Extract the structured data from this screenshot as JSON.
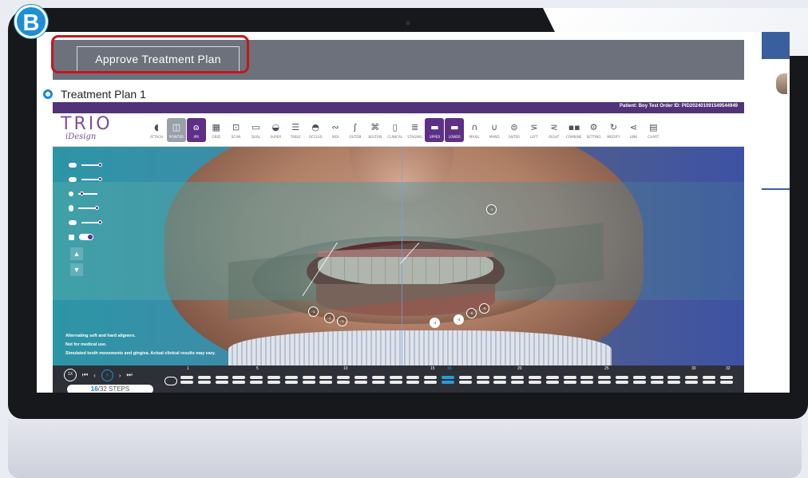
{
  "badge": "B",
  "approve_button": "Approve Treatment Plan",
  "plan_label": "Treatment Plan 1",
  "app": {
    "patient_info": "Patient: Boy Test   Order ID: PID202401091549544949",
    "logo_main": "TRIO",
    "logo_sub": "iDesign",
    "tools": [
      {
        "label": "ATTACH",
        "icon": "attach-icon",
        "glyph": "◖",
        "state": "normal"
      },
      {
        "label": "POINTER",
        "icon": "pointer-icon",
        "glyph": "◫",
        "state": "grey"
      },
      {
        "label": "IPR",
        "icon": "ipr-icon",
        "glyph": "ɷ",
        "state": "active"
      },
      {
        "label": "GRID",
        "icon": "grid-icon",
        "glyph": "▦",
        "state": "normal"
      },
      {
        "label": "SCAN",
        "icon": "scan-icon",
        "glyph": "⊡",
        "state": "normal"
      },
      {
        "label": "DUAL",
        "icon": "dual-icon",
        "glyph": "▭",
        "state": "normal"
      },
      {
        "label": "SUPER",
        "icon": "super-icon",
        "glyph": "◒",
        "state": "normal"
      },
      {
        "label": "TABLE",
        "icon": "table-icon",
        "glyph": "☰",
        "state": "normal"
      },
      {
        "label": "OCCLUS",
        "icon": "occlusion-icon",
        "glyph": "◓",
        "state": "normal"
      },
      {
        "label": "MDI",
        "icon": "mdi-icon",
        "glyph": "∾",
        "state": "normal"
      },
      {
        "label": "OUTDB",
        "icon": "outdb-icon",
        "glyph": "ʃ",
        "state": "normal"
      },
      {
        "label": "BOLTON",
        "icon": "bolton-icon",
        "glyph": "⌘",
        "state": "normal"
      },
      {
        "label": "CLINICAL",
        "icon": "clinical-icon",
        "glyph": "▯",
        "state": "normal"
      },
      {
        "label": "STAGING",
        "icon": "staging-icon",
        "glyph": "≣",
        "state": "normal"
      },
      {
        "label": "UPPER",
        "icon": "upper-jaw-icon",
        "glyph": "▬",
        "state": "active"
      },
      {
        "label": "LOWER",
        "icon": "lower-jaw-icon",
        "glyph": "▬",
        "state": "active"
      },
      {
        "label": "MAXIL",
        "icon": "maxilla-icon",
        "glyph": "∩",
        "state": "normal"
      },
      {
        "label": "MAND",
        "icon": "mandible-icon",
        "glyph": "∪",
        "state": "normal"
      },
      {
        "label": "ANTER",
        "icon": "anterior-icon",
        "glyph": "⊜",
        "state": "normal"
      },
      {
        "label": "LEFT",
        "icon": "left-view-icon",
        "glyph": "⋝",
        "state": "normal"
      },
      {
        "label": "RIGHT",
        "icon": "right-view-icon",
        "glyph": "⋜",
        "state": "normal"
      },
      {
        "label": "COMBINE",
        "icon": "combine-icon",
        "glyph": "▪▪",
        "state": "normal"
      },
      {
        "label": "SETTING",
        "icon": "setting-icon",
        "glyph": "⚙",
        "state": "normal"
      },
      {
        "label": "MODIFY",
        "icon": "modify-icon",
        "glyph": "↻",
        "state": "normal"
      },
      {
        "label": "LINK",
        "icon": "link-icon",
        "glyph": "⋖",
        "state": "normal"
      },
      {
        "label": "CHART",
        "icon": "chart-icon",
        "glyph": "▤",
        "state": "normal"
      }
    ],
    "disclaimer": [
      "Alternating soft and hard aligners.",
      "Not for medical use.",
      "Simulated tooth movements and gingiva. Actual clinical results may vary."
    ],
    "markers": [
      "-1",
      "-1",
      "-1",
      "-1",
      "-4",
      "-4",
      "-5",
      "-5"
    ],
    "steps": {
      "speed": "1X",
      "current": "16",
      "total_label": "/32 STEPS",
      "tick_labels": [
        "1",
        "5",
        "10",
        "15",
        "16",
        "20",
        "25",
        "30",
        "32"
      ]
    }
  },
  "colors": {
    "accent": "#5d2f86",
    "highlight": "#c4161c",
    "badge": "#1e8fd3",
    "step_active": "#2b9bd8"
  }
}
